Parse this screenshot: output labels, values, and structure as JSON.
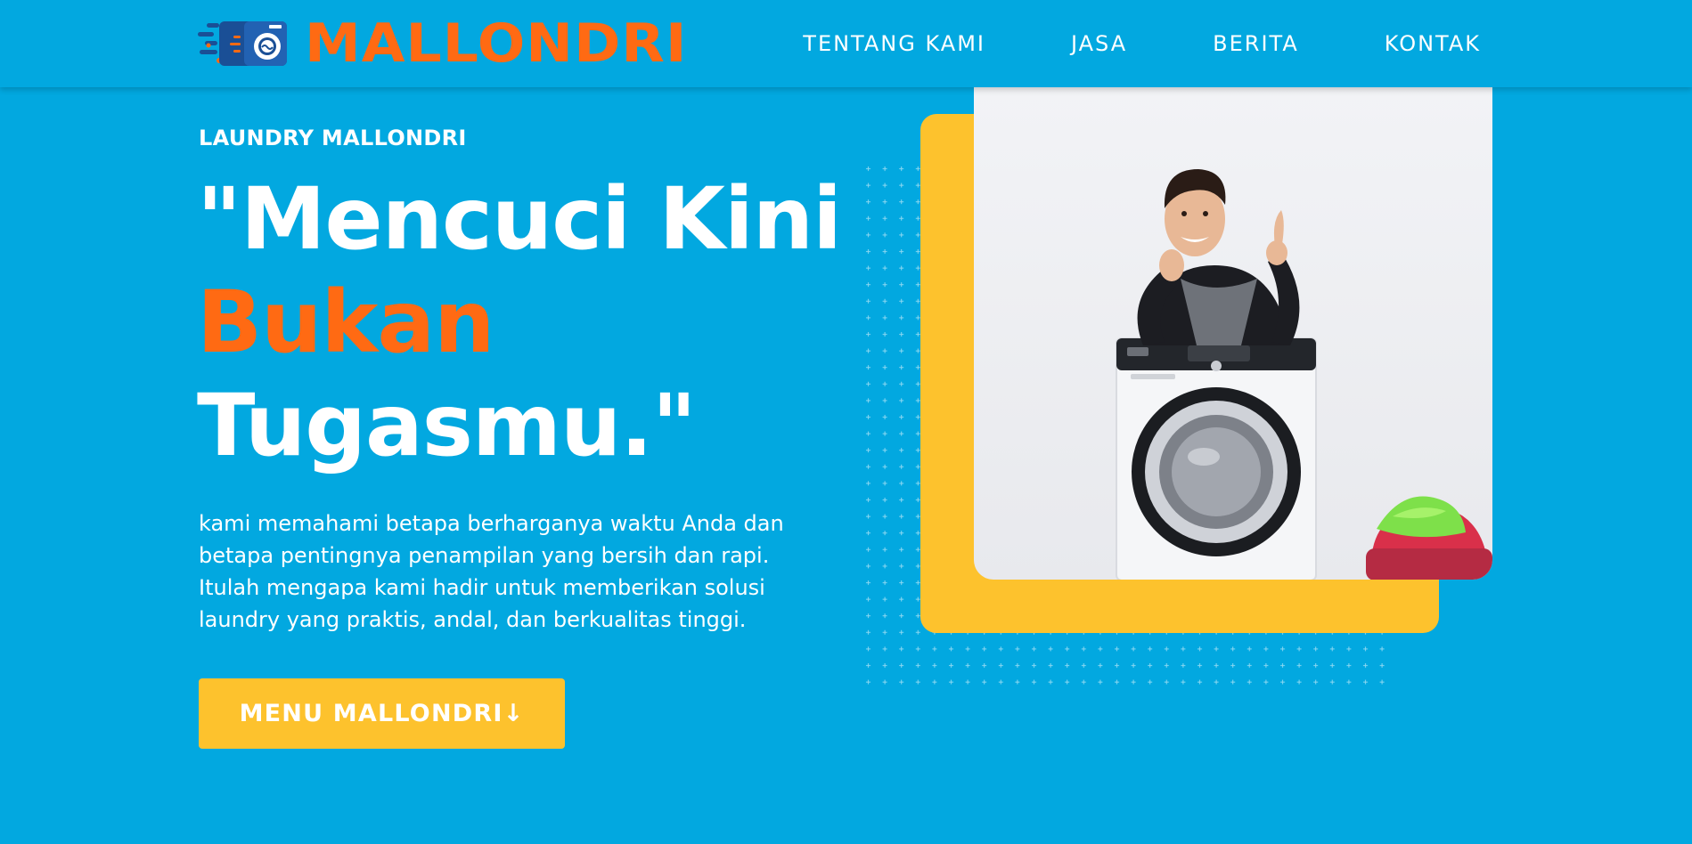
{
  "brand": {
    "name": "MALLONDRI",
    "logo_icon": "washing-machine-speed-logo",
    "color": "#ff6a13"
  },
  "nav": {
    "items": [
      {
        "label": "TENTANG KAMI"
      },
      {
        "label": "JASA"
      },
      {
        "label": "BERITA"
      },
      {
        "label": "KONTAK"
      }
    ]
  },
  "hero": {
    "eyebrow": "LAUNDRY MALLONDRI",
    "headline": {
      "line1": "\"Mencuci Kini",
      "line2": "Bukan",
      "line3": "Tugasmu.\""
    },
    "description": "kami memahami betapa berharganya waktu Anda dan betapa pentingnya penampilan yang bersih dan rapi. Itulah mengapa kami hadir untuk memberikan solusi laundry yang praktis, andal, dan berkualitas tinggi.",
    "cta_label": "MENU MALLONDRI↓",
    "photo_icon": "man-leaning-on-washing-machine-photo"
  },
  "colors": {
    "background": "#02a8e0",
    "accent_orange": "#ff6a13",
    "accent_yellow": "#fdc22d"
  }
}
